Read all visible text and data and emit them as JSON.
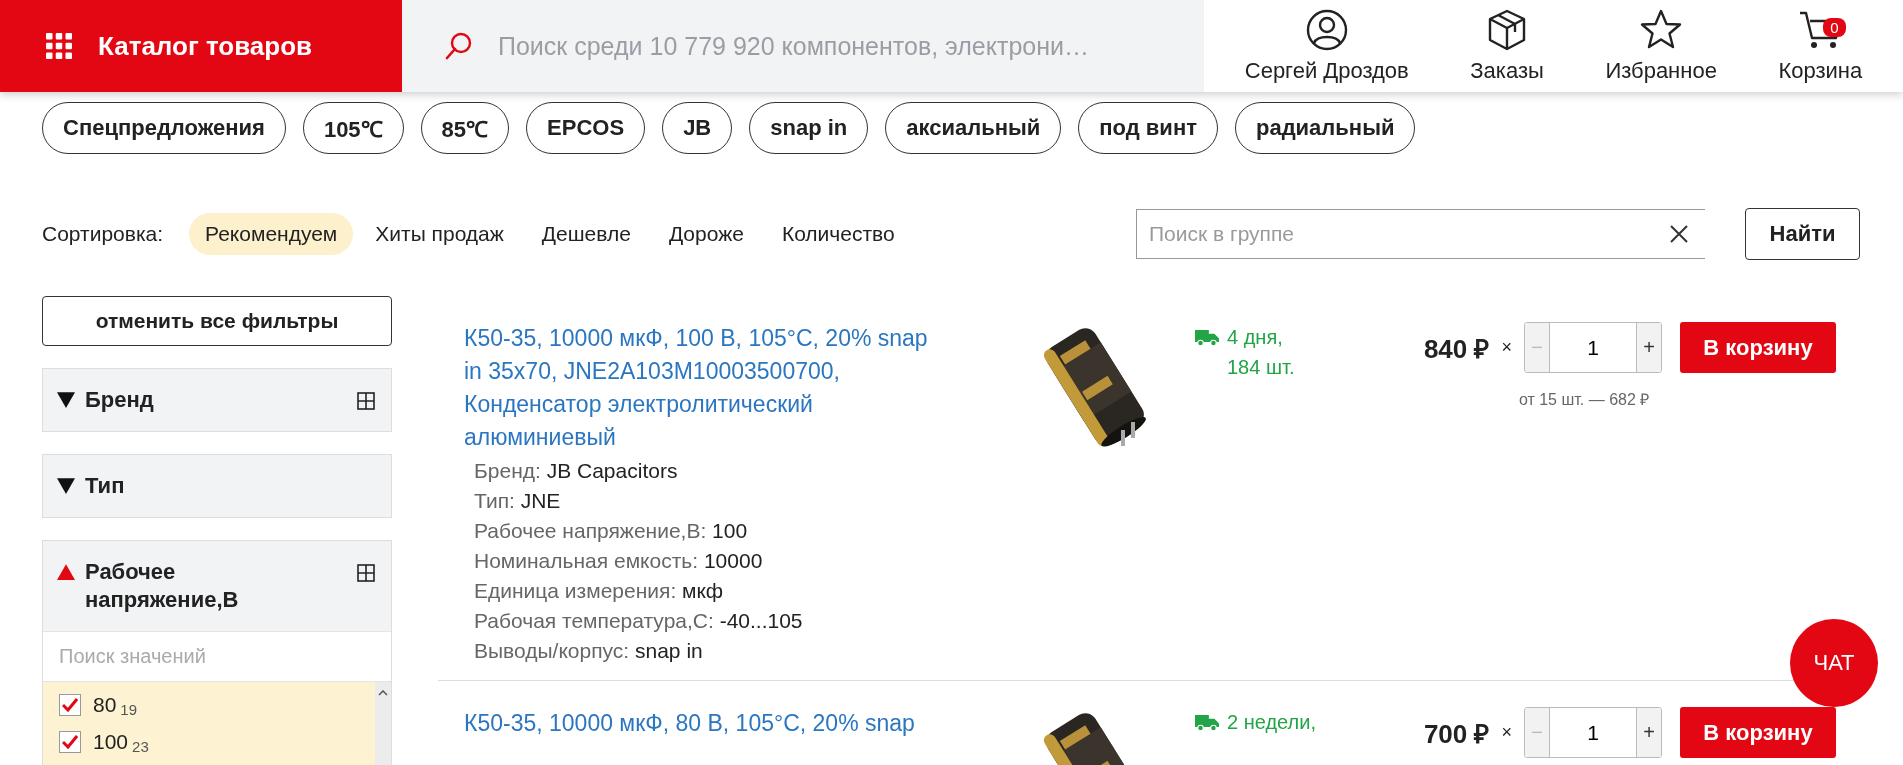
{
  "header": {
    "catalog_button": "Каталог товаров",
    "search": {
      "placeholder": "Поиск среди 10 779 920 компонентов, электрони…"
    },
    "nav": [
      {
        "kind": "user",
        "label": "Сергей Дроздов"
      },
      {
        "kind": "orders",
        "label": "Заказы"
      },
      {
        "kind": "favorites",
        "label": "Избранное"
      },
      {
        "kind": "cart",
        "label": "Корзина",
        "badge": "0"
      }
    ]
  },
  "chips": [
    "Спецпредложения",
    "105℃",
    "85℃",
    "EPCOS",
    "JB",
    "snap in",
    "аксиальный",
    "под винт",
    "радиальный"
  ],
  "sort": {
    "label": "Сортировка:",
    "options": [
      {
        "label": "Рекомендуем",
        "selected": true
      },
      {
        "label": "Хиты продаж",
        "selected": false
      },
      {
        "label": "Дешевле",
        "selected": false
      },
      {
        "label": "Дороже",
        "selected": false
      },
      {
        "label": "Количество",
        "selected": false
      }
    ]
  },
  "group_search": {
    "placeholder": "Поиск в группе",
    "button": "Найти"
  },
  "filters": {
    "reset_button": "отменить все фильтры",
    "groups": [
      {
        "title": "Бренд",
        "expanded": false,
        "grid_toggle": true
      },
      {
        "title": "Тип",
        "expanded": false,
        "grid_toggle": false
      },
      {
        "title": "Рабочее напряжение,В",
        "expanded": true,
        "grid_toggle": true,
        "search_placeholder": "Поиск значений",
        "values": [
          {
            "label": "80",
            "count": "19",
            "checked": true
          },
          {
            "label": "100",
            "count": "23",
            "checked": true
          }
        ]
      }
    ]
  },
  "products": [
    {
      "title": "К50-35, 10000 мкФ, 100 В, 105°C, 20% snap in 35x70, JNE2A103M10003500700, Конденсатор электролитический алюминиевый",
      "properties": [
        {
          "name": "Бренд:",
          "value": "JB Capacitors"
        },
        {
          "name": "Тип:",
          "value": "JNE"
        },
        {
          "name": "Рабочее напряжение,В:",
          "value": "100"
        },
        {
          "name": "Номинальная емкость:",
          "value": "10000"
        },
        {
          "name": "Единица измерения:",
          "value": "мкф"
        },
        {
          "name": "Рабочая температура,С:",
          "value": "-40...105"
        },
        {
          "name": "Выводы/корпус:",
          "value": "snap in"
        }
      ],
      "delivery": [
        "4 дня,",
        "184 шт."
      ],
      "price": "840 ₽",
      "times": "×",
      "decrease": "−",
      "quantity": "1",
      "increase": "+",
      "volume_price": "от 15 шт. — 682 ₽",
      "cart_button": "В корзину"
    },
    {
      "title": "К50-35, 10000 мкФ, 80 В, 105°C, 20% snap",
      "delivery": [
        "2 недели,"
      ],
      "price": "700 ₽",
      "times": "×",
      "decrease": "−",
      "quantity": "1",
      "increase": "+",
      "cart_button": "В корзину"
    }
  ],
  "chat_button": "ЧАТ"
}
